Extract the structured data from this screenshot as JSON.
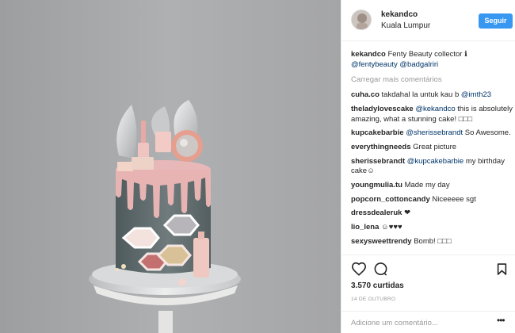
{
  "post": {
    "username": "kekandco",
    "location": "Kuala Lumpur",
    "follow_label": "Seguir",
    "caption": {
      "user": "kekandco",
      "text": "Fenty Beauty collector",
      "emoji": "ℹ",
      "tags": [
        "@fentybeauty",
        "@badgalriri"
      ]
    },
    "load_more": "Carregar mais comentários",
    "comments": [
      {
        "user": "cuha.co",
        "text": "takdahal la untuk kau b",
        "mention": "@imth23",
        "suffix": ""
      },
      {
        "user": "theladylovescake",
        "text": "",
        "mention": "@kekandco",
        "suffix": "this is absolutely amazing, what a stunning cake! □□□"
      },
      {
        "user": "kupcakebarbie",
        "text": "",
        "mention": "@sherissebrandt",
        "suffix": "So Awesome."
      },
      {
        "user": "everythingneeds",
        "text": "Great picture",
        "mention": "",
        "suffix": ""
      },
      {
        "user": "sherissebrandt",
        "text": "",
        "mention": "@kupcakebarbie",
        "suffix": "my birthday cake☺"
      },
      {
        "user": "youngmulia.tu",
        "text": "Made my day",
        "mention": "",
        "suffix": ""
      },
      {
        "user": "popcorn_cottoncandy",
        "text": "Niceeeee sgt",
        "mention": "",
        "suffix": ""
      },
      {
        "user": "dressdealeruk",
        "text": "❤",
        "mention": "",
        "suffix": ""
      },
      {
        "user": "lio_lena",
        "text": "☺♥♥♥",
        "mention": "",
        "suffix": ""
      },
      {
        "user": "sexysweettrendy",
        "text": "Bomb! □□□",
        "mention": "",
        "suffix": ""
      }
    ],
    "likes": "3.570 curtidas",
    "date": "14 DE OUTUBRO",
    "add_comment_placeholder": "Adicione um comentário...",
    "more_options": "•••"
  },
  "icons": {
    "like": "heart-icon",
    "comment": "comment-bubble-icon",
    "save": "bookmark-icon",
    "more": "ellipsis-icon"
  },
  "colors": {
    "follow_button": "#3897f0",
    "link": "#003569",
    "muted": "#999999",
    "photo_background": "#a7a8aa"
  }
}
